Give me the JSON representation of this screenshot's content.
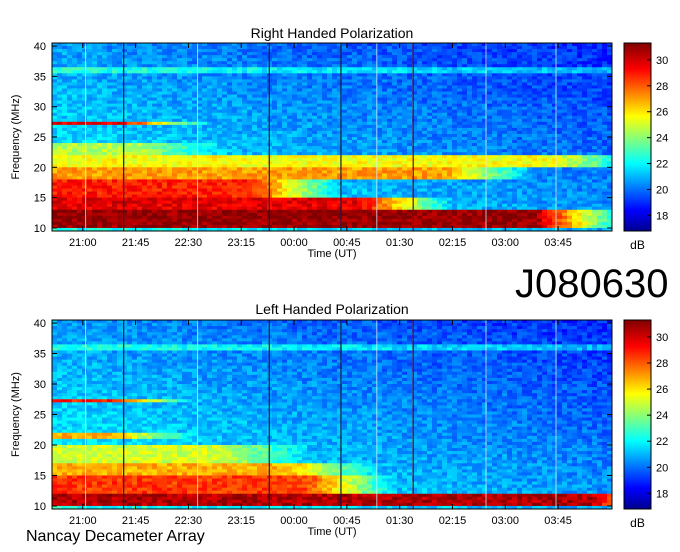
{
  "observation_id": "J080630",
  "footer": "Nancay Decameter Array",
  "chart_data": [
    {
      "type": "heatmap",
      "title": "Right Handed Polarization",
      "xlabel": "Time (UT)",
      "ylabel": "Frequency (MHz)",
      "x_ticks": [
        "21:00",
        "21:45",
        "22:30",
        "23:15",
        "00:00",
        "00:45",
        "01:30",
        "02:15",
        "03:00",
        "03:45"
      ],
      "y_ticks": [
        10,
        15,
        20,
        25,
        30,
        35,
        40
      ],
      "ylim": [
        9.5,
        40.5
      ],
      "colorbar": {
        "label": "dB",
        "ticks": [
          18,
          20,
          22,
          24,
          26,
          28,
          30
        ],
        "range": [
          16.8,
          31.3
        ]
      },
      "bands": [
        {
          "freq": [
            10,
            13
          ],
          "level": 0.98,
          "until": 0.86
        },
        {
          "freq": [
            13,
            15
          ],
          "level": 0.9,
          "until": 0.55
        },
        {
          "freq": [
            15,
            18
          ],
          "level": 0.85,
          "until": 0.35
        },
        {
          "freq": [
            18,
            20
          ],
          "level": 0.72,
          "until": 0.7
        },
        {
          "freq": [
            20,
            22
          ],
          "level": 0.62,
          "until": 0.9
        },
        {
          "freq": [
            22,
            24
          ],
          "level": 0.55,
          "until": 0.15
        },
        {
          "freq": [
            27,
            27.5
          ],
          "level": 0.9,
          "until": 0.12
        }
      ]
    },
    {
      "type": "heatmap",
      "title": "Left Handed Polarization",
      "xlabel": "Time (UT)",
      "ylabel": "Frequency (MHz)",
      "x_ticks": [
        "21:00",
        "21:45",
        "22:30",
        "23:15",
        "00:00",
        "00:45",
        "01:30",
        "02:15",
        "03:00",
        "03:45"
      ],
      "y_ticks": [
        10,
        15,
        20,
        25,
        30,
        35,
        40
      ],
      "ylim": [
        9.5,
        40.5
      ],
      "colorbar": {
        "label": "dB",
        "ticks": [
          18,
          20,
          22,
          24,
          26,
          28,
          30
        ],
        "range": [
          16.8,
          31.3
        ]
      },
      "bands": [
        {
          "freq": [
            10,
            12
          ],
          "level": 0.95,
          "until": 0.96
        },
        {
          "freq": [
            12,
            15
          ],
          "level": 0.82,
          "until": 0.45
        },
        {
          "freq": [
            15,
            17
          ],
          "level": 0.7,
          "until": 0.42
        },
        {
          "freq": [
            17,
            20
          ],
          "level": 0.58,
          "until": 0.3
        },
        {
          "freq": [
            21,
            22
          ],
          "level": 0.7,
          "until": 0.1
        },
        {
          "freq": [
            27,
            27.5
          ],
          "level": 0.85,
          "until": 0.1
        }
      ]
    }
  ]
}
